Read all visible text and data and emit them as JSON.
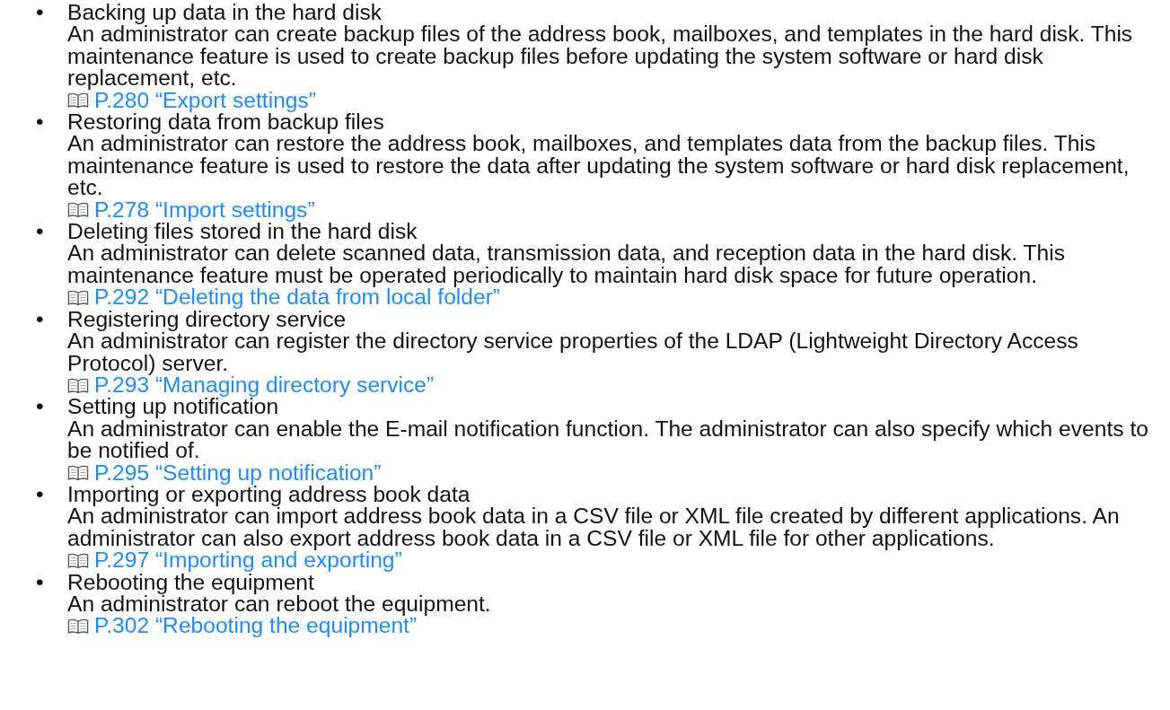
{
  "items": [
    {
      "bullet": "•",
      "title": "Backing up data in the hard disk",
      "description": "An administrator can create backup files of the address book, mailboxes, and templates in the hard disk. This maintenance feature is used to create backup files before updating the system software or hard disk replacement, etc.",
      "link": "P.280 “Export settings”"
    },
    {
      "bullet": "•",
      "title": "Restoring data from backup files",
      "description": "An administrator can restore the address book, mailboxes, and templates data from the backup files. This maintenance feature is used to restore the data after updating the system software or hard disk replacement, etc.",
      "link": "P.278 “Import settings”"
    },
    {
      "bullet": "•",
      "title": "Deleting files stored in the hard disk",
      "description": "An administrator can delete scanned data, transmission data, and reception data in the hard disk. This maintenance feature must be operated periodically to maintain hard disk space for future operation.",
      "link": "P.292 “Deleting the data from local folder”"
    },
    {
      "bullet": "•",
      "title": "Registering directory service",
      "description": "An administrator can register the directory service properties of the LDAP (Lightweight Directory Access Protocol) server.",
      "link": "P.293 “Managing directory service”"
    },
    {
      "bullet": "•",
      "title": "Setting up notification",
      "description": "An administrator can enable the E-mail notification function. The administrator can also specify which events to be notified of.",
      "link": "P.295 “Setting up notification”"
    },
    {
      "bullet": "•",
      "title": "Importing or exporting address book data",
      "description": "An administrator can import address book data in a CSV file or XML file created by different applications. An administrator can also export address book data in a CSV file or XML file for other applications.",
      "link": "P.297 “Importing and exporting”"
    },
    {
      "bullet": "•",
      "title": "Rebooting the equipment",
      "description": "An administrator can reboot the equipment.",
      "link": "P.302 “Rebooting the equipment”"
    }
  ]
}
